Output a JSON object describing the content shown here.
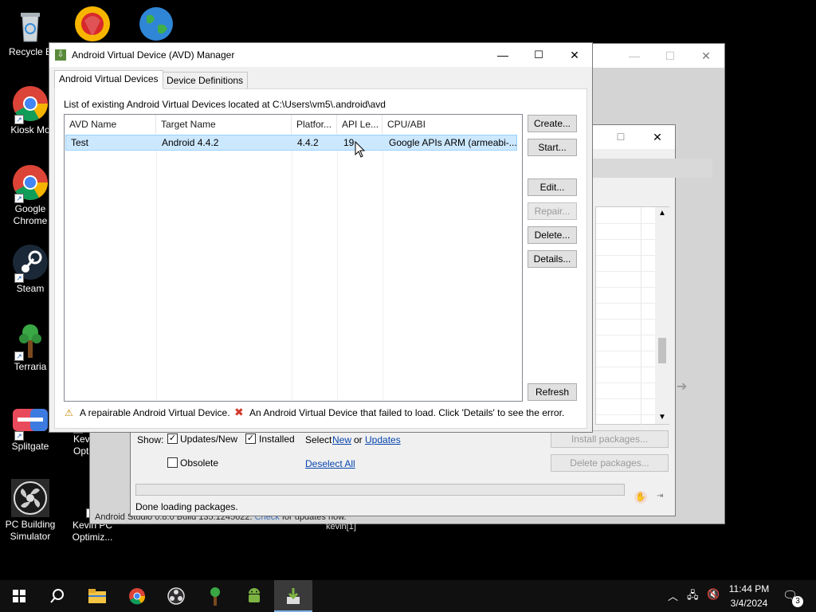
{
  "desktop": {
    "icons": [
      {
        "label": "Recycle B",
        "icon": "recycle-bin-icon"
      },
      {
        "label": "Kiosk Mo",
        "icon": "chrome-icon"
      },
      {
        "label": "Google Chrome",
        "icon": "chrome-icon"
      },
      {
        "label": "Steam",
        "icon": "steam-icon"
      },
      {
        "label": "Terraria",
        "icon": "tree-icon"
      },
      {
        "label": "Splitgate",
        "icon": "splitgate-icon"
      },
      {
        "label": "PC Building Simulator",
        "icon": "fan-icon"
      },
      {
        "label": "Kev Optim",
        "icon": "app-icon"
      },
      {
        "label": "Kevin PC Optimiz...",
        "icon": "app-icon"
      }
    ],
    "top_icons": [
      "browser-icon",
      "globe-icon"
    ]
  },
  "sdk_manager": {
    "show_label": "Show:",
    "updates_new_label": "Updates/New",
    "installed_label": "Installed",
    "select_label": "Select",
    "new_link": "New",
    "or_label": "or",
    "updates_link": "Updates",
    "obsolete_label": "Obsolete",
    "deselect_all_link": "Deselect All",
    "install_button": "Install packages...",
    "delete_button": "Delete packages...",
    "status_text": "Done loading packages.",
    "updates_new_checked": true,
    "installed_checked": true,
    "obsolete_checked": false
  },
  "studio_window": {
    "status_text": "Android Studio 0.8.0 Build 135.1245622.",
    "check_link": "Check",
    "status_tail": "for updates now.",
    "user_text": "kevin[1]"
  },
  "avd_manager": {
    "title": "Android Virtual Device (AVD) Manager",
    "tabs": [
      "Android Virtual Devices",
      "Device Definitions"
    ],
    "location_text": "List of existing Android Virtual Devices located at C:\\Users\\vm5\\.android\\avd",
    "columns": [
      "AVD Name",
      "Target Name",
      "Platfor...",
      "API Le...",
      "CPU/ABI"
    ],
    "rows": [
      {
        "name": "Test",
        "target": "Android 4.4.2",
        "platform": "4.4.2",
        "api": "19",
        "cpu": "Google APIs ARM (armeabi-..."
      }
    ],
    "buttons": {
      "create": "Create...",
      "start": "Start...",
      "edit": "Edit...",
      "repair": "Repair...",
      "delete": "Delete...",
      "details": "Details...",
      "refresh": "Refresh"
    },
    "legend_repairable": "A repairable Android Virtual Device.",
    "legend_failed": "An Android Virtual Device that failed to load. Click 'Details' to see the error."
  },
  "taskbar": {
    "time": "11:44 PM",
    "date": "3/4/2024",
    "notification_count": "3",
    "apps": [
      "start-icon",
      "search-icon",
      "file-explorer-icon",
      "chrome-icon",
      "obs-icon",
      "terraria-icon",
      "android-icon",
      "avd-manager-icon"
    ]
  },
  "colors": {
    "selection": "#cce8ff",
    "link": "#0645ad",
    "taskbar": "#101010",
    "accent": "#7fb0e8"
  }
}
